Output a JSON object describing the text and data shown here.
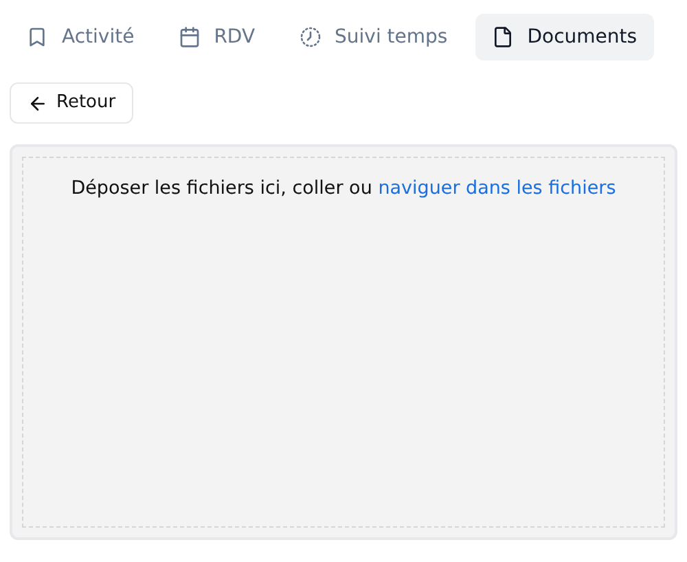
{
  "tabs": [
    {
      "label": "Activité",
      "selected": false
    },
    {
      "label": "RDV",
      "selected": false
    },
    {
      "label": "Suivi temps",
      "selected": false
    },
    {
      "label": "Documents",
      "selected": true
    }
  ],
  "back_button": {
    "label": "Retour"
  },
  "dropzone": {
    "text": "Déposer les fichiers ici, coller ou",
    "link": "naviguer dans les fichiers"
  }
}
